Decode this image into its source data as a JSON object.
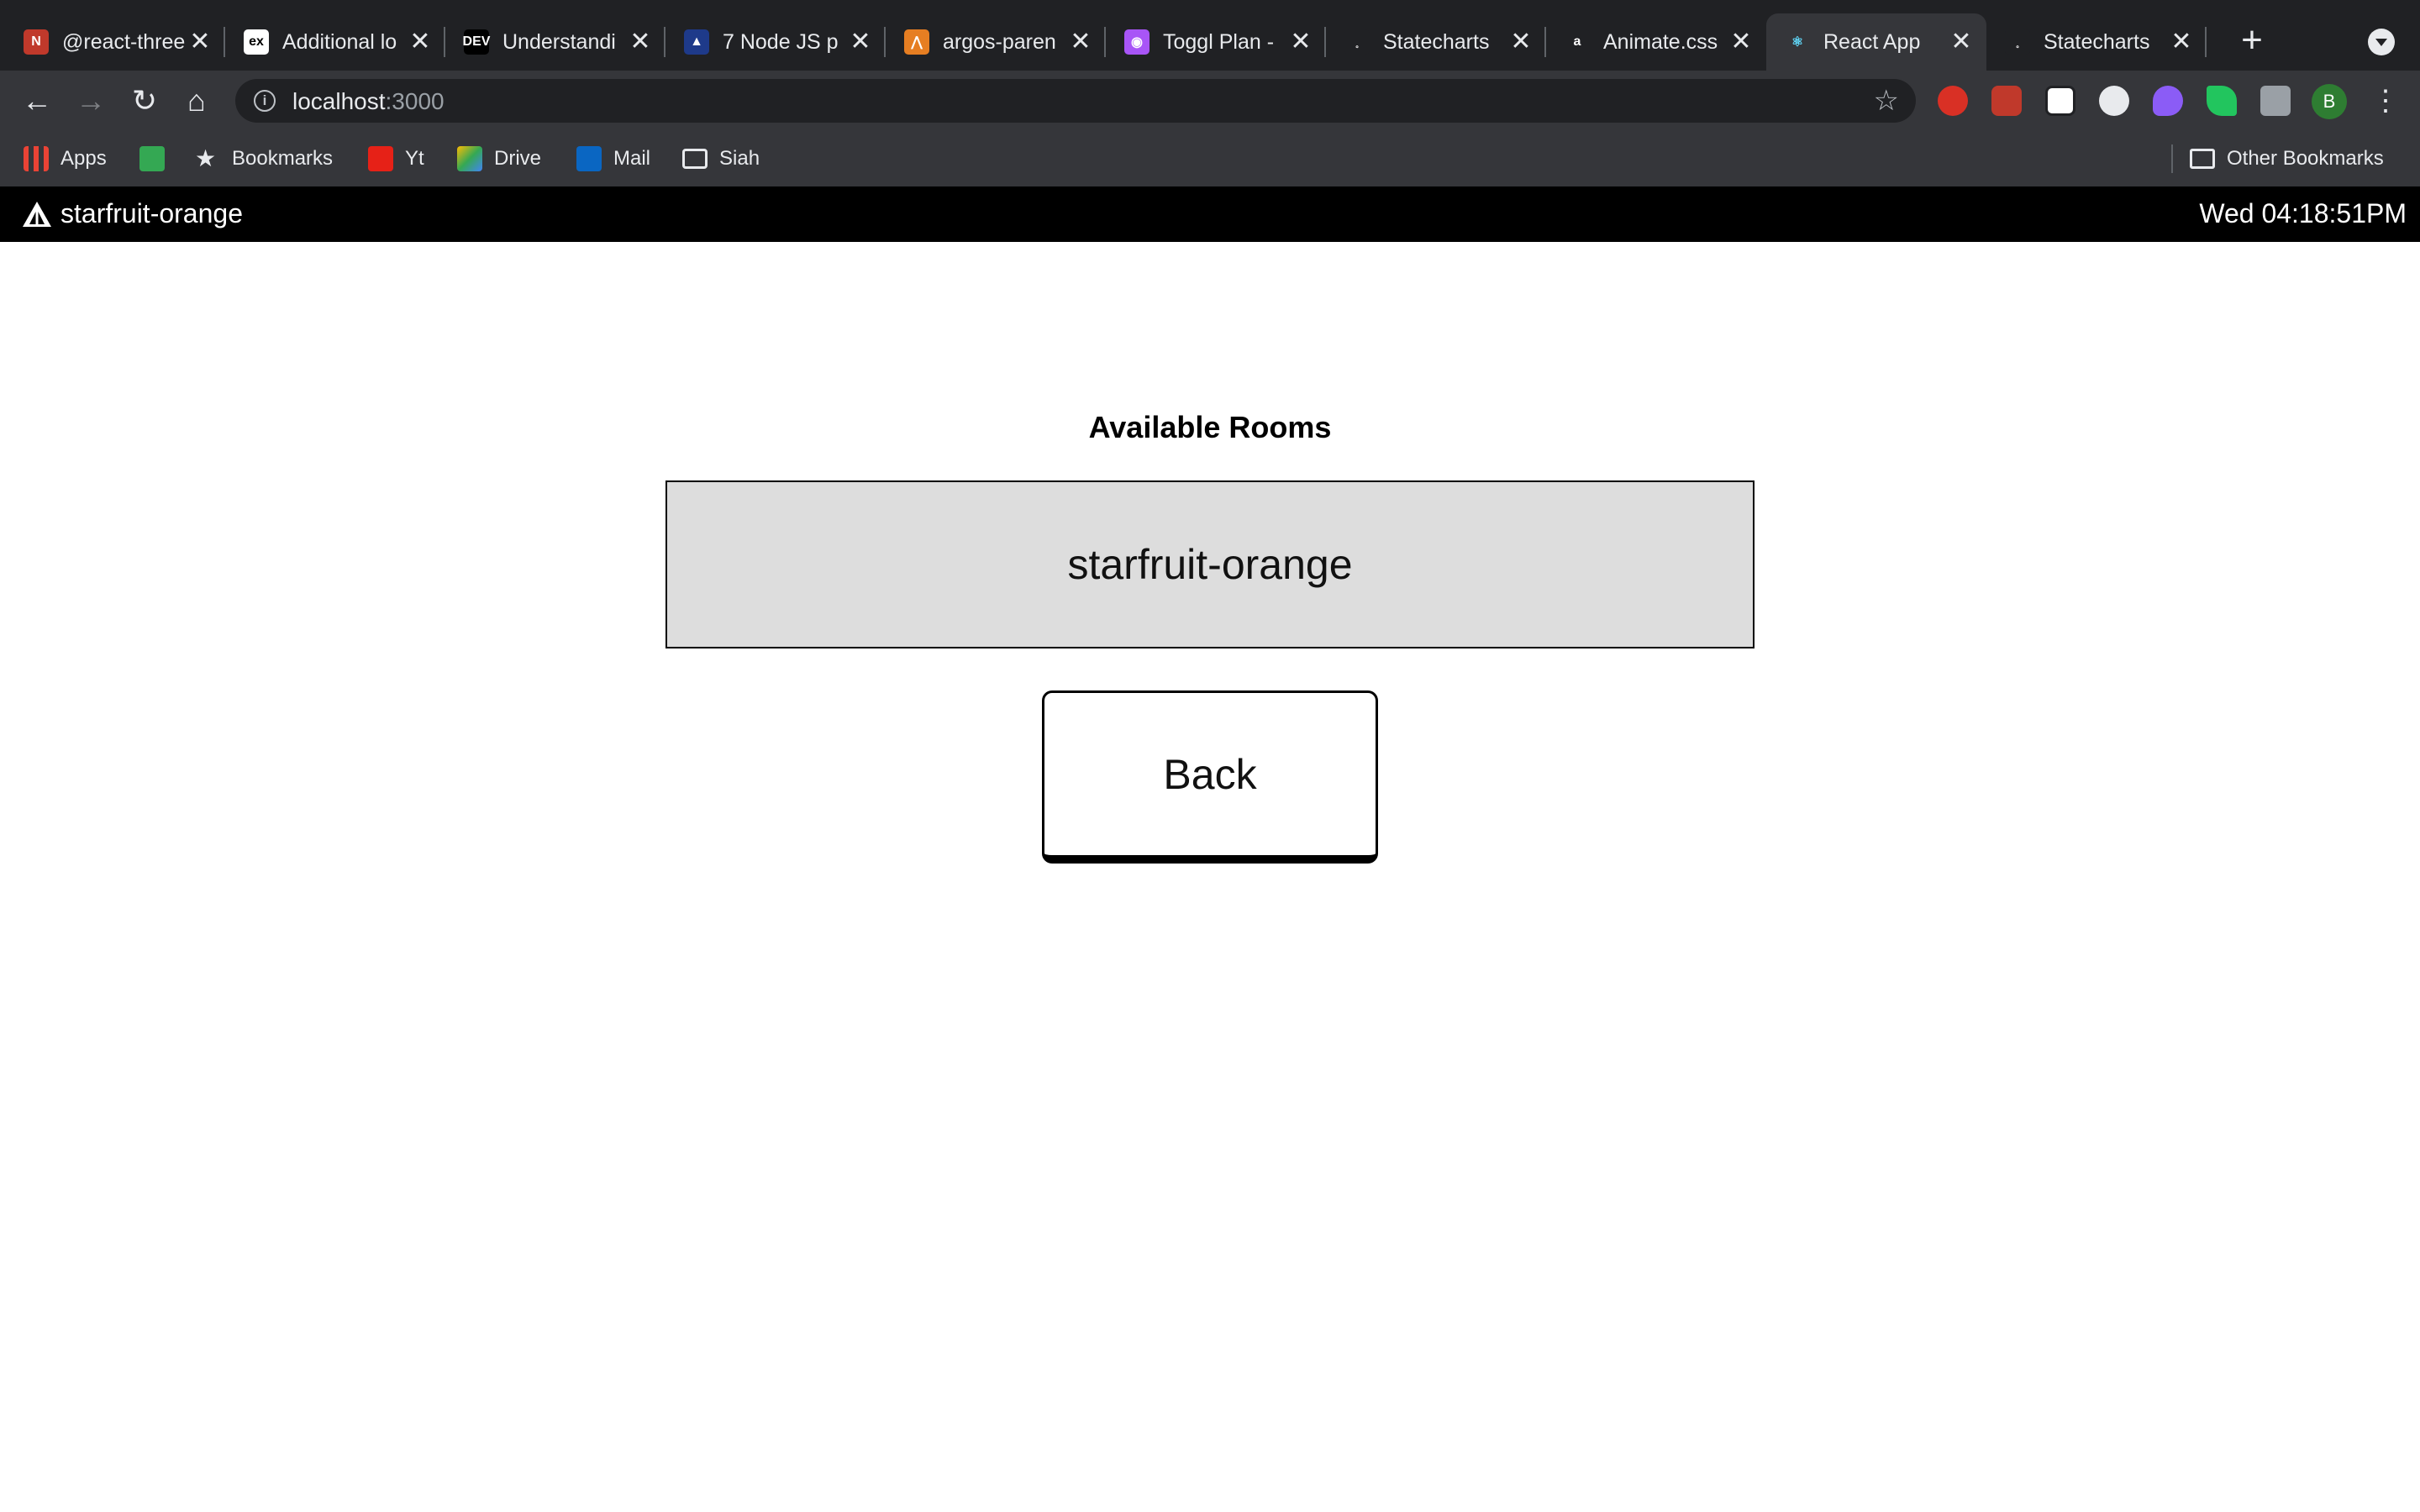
{
  "browser": {
    "tabs": [
      {
        "title": "@react-three",
        "favicon": "n-icon",
        "color": "#c0392b",
        "glyph": "N"
      },
      {
        "title": "Additional lo",
        "favicon": "ex-icon",
        "color": "#ffffff",
        "glyph": "ex"
      },
      {
        "title": "Understandi",
        "favicon": "dev-icon",
        "color": "#000000",
        "glyph": "DEV"
      },
      {
        "title": "7 Node JS p",
        "favicon": "graduation-cap-icon",
        "color": "#1e3a8a",
        "glyph": "▲"
      },
      {
        "title": "argos-paren",
        "favicon": "argos-icon",
        "color": "#e67e22",
        "glyph": "⋀"
      },
      {
        "title": "Toggl Plan -",
        "favicon": "toggl-icon",
        "color": "#a855f7",
        "glyph": "◉"
      },
      {
        "title": "Statecharts",
        "favicon": "statecharts-icon",
        "color": "#202124",
        "glyph": "˳"
      },
      {
        "title": "Animate.css",
        "favicon": "animate-icon",
        "color": "#202124",
        "glyph": "a"
      },
      {
        "title": "React App",
        "favicon": "react-icon",
        "color": "#35363a",
        "glyph": "⚛"
      },
      {
        "title": "Statecharts",
        "favicon": "statecharts-icon",
        "color": "#202124",
        "glyph": "˳"
      }
    ],
    "active_tab": 8,
    "close_glyph": "✕",
    "new_tab_glyph": "+",
    "url_host": "localhost",
    "url_port": ":3000",
    "bookmarks": [
      {
        "label": "Apps",
        "icon": "apps-grid-icon"
      },
      {
        "label": "",
        "icon": "sheets-icon"
      },
      {
        "label": "Bookmarks",
        "icon": "star-icon"
      },
      {
        "label": "Yt",
        "icon": "youtube-icon"
      },
      {
        "label": "Drive",
        "icon": "drive-icon"
      },
      {
        "label": "Mail",
        "icon": "outlook-icon"
      },
      {
        "label": "Siah",
        "icon": "folder-icon"
      }
    ],
    "other_bookmarks": "Other Bookmarks",
    "profile_initial": "B"
  },
  "app": {
    "room_name": "starfruit-orange",
    "clock": "Wed 04:18:51PM",
    "heading": "Available Rooms",
    "rooms": [
      "starfruit-orange"
    ],
    "back_label": "Back"
  }
}
